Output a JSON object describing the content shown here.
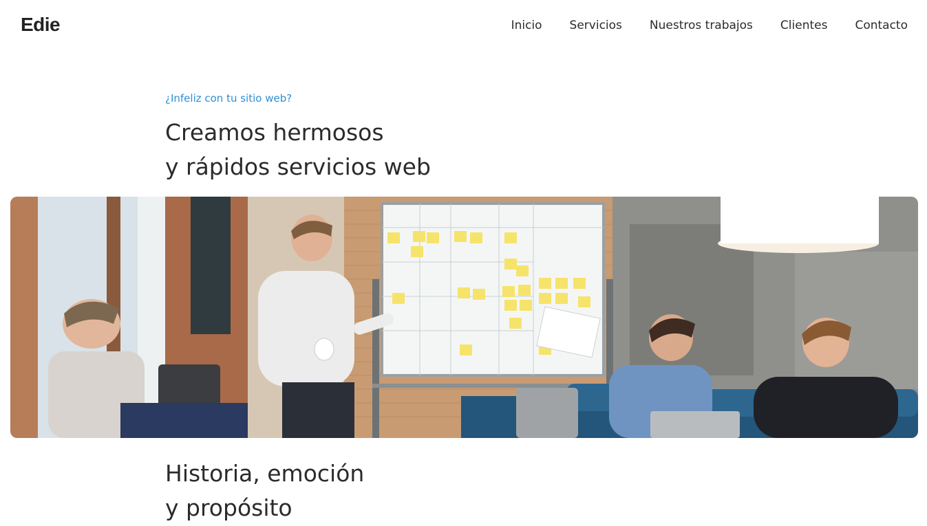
{
  "header": {
    "logo": "Edie",
    "nav": [
      {
        "label": "Inicio"
      },
      {
        "label": "Servicios"
      },
      {
        "label": "Nuestros trabajos"
      },
      {
        "label": "Clientes"
      },
      {
        "label": "Contacto"
      }
    ]
  },
  "hero": {
    "eyebrow": "¿Infeliz con tu sitio web?",
    "title_line1": "Creamos hermosos",
    "title_line2": "y rápidos servicios web"
  },
  "section": {
    "title_line1": "Historia, emoción",
    "title_line2": "y propósito"
  }
}
